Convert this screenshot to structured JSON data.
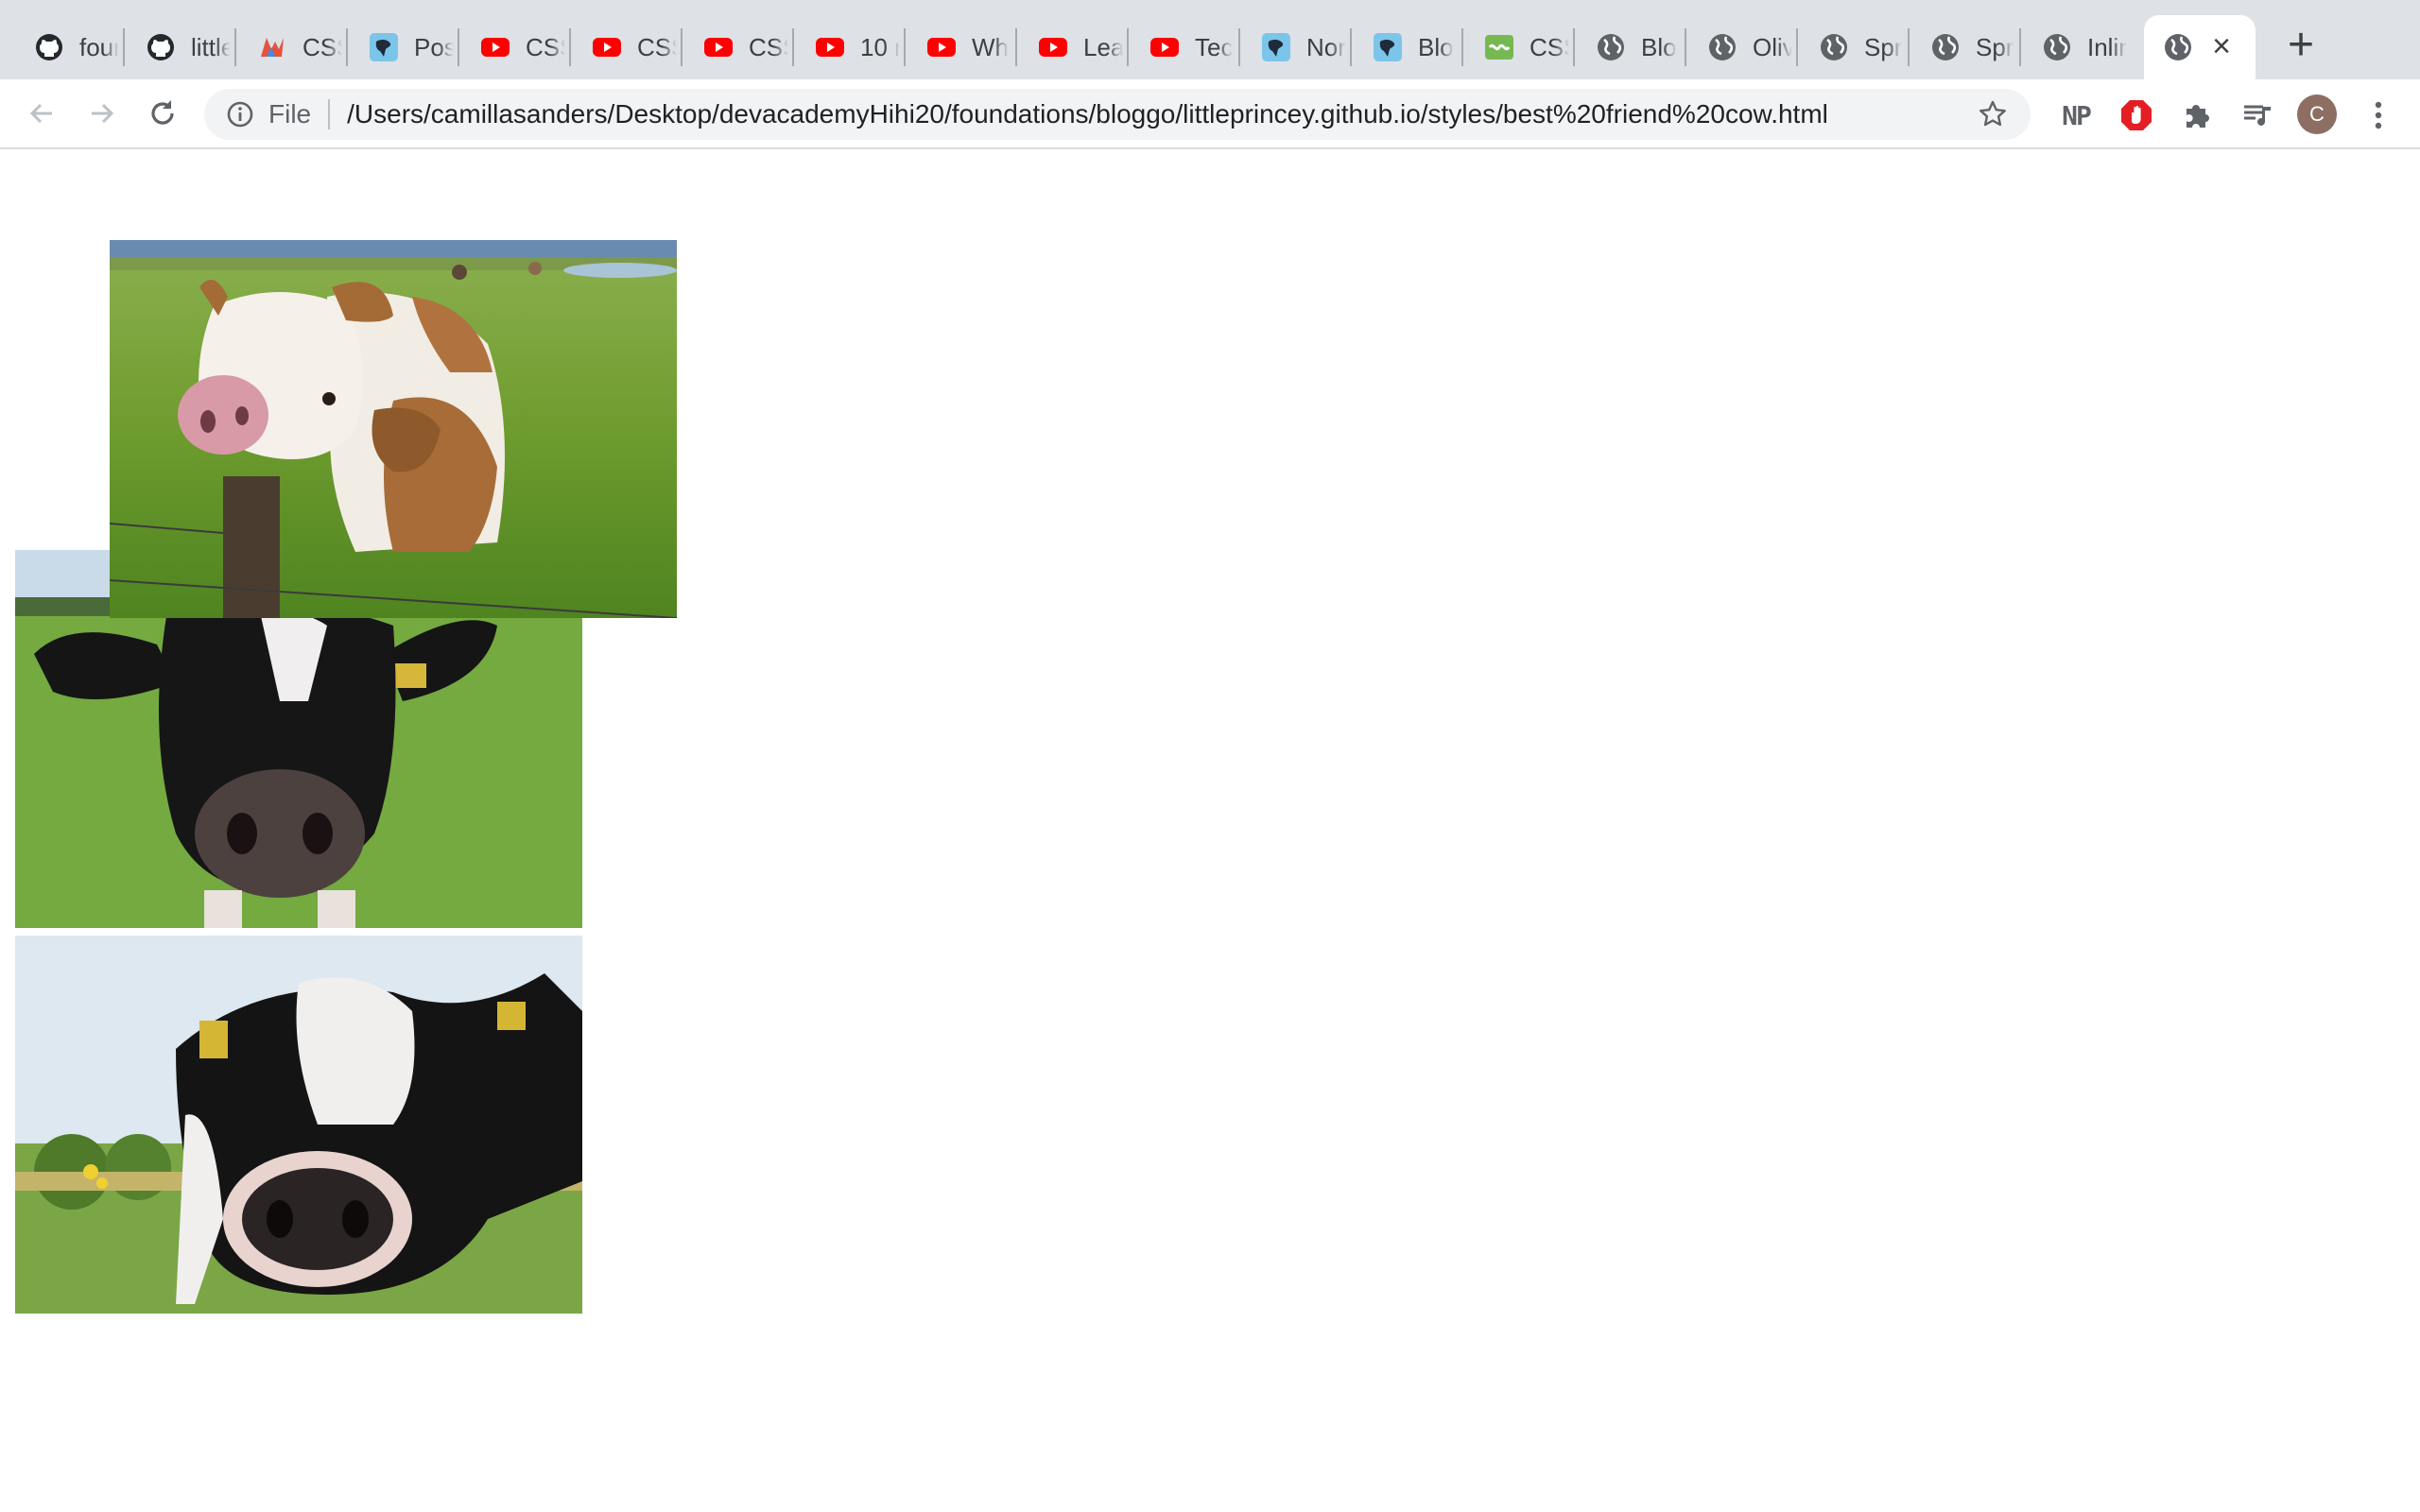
{
  "browser": {
    "tabs": [
      {
        "title": "four",
        "icon": "github-icon"
      },
      {
        "title": "little",
        "icon": "github-icon"
      },
      {
        "title": "CSS",
        "icon": "css-tricks-icon"
      },
      {
        "title": "Pos",
        "icon": "site-icon"
      },
      {
        "title": "CSS",
        "icon": "youtube-icon"
      },
      {
        "title": "CSS",
        "icon": "youtube-icon"
      },
      {
        "title": "CSS",
        "icon": "youtube-icon"
      },
      {
        "title": "10 r",
        "icon": "youtube-icon"
      },
      {
        "title": "Wh",
        "icon": "youtube-icon"
      },
      {
        "title": "Lea",
        "icon": "youtube-icon"
      },
      {
        "title": "Tec",
        "icon": "youtube-icon"
      },
      {
        "title": "Nor",
        "icon": "site-icon"
      },
      {
        "title": "Blo",
        "icon": "site-icon"
      },
      {
        "title": "CSS",
        "icon": "green-site-icon"
      },
      {
        "title": "Blo",
        "icon": "globe-icon"
      },
      {
        "title": "Oliv",
        "icon": "globe-icon"
      },
      {
        "title": "Spr",
        "icon": "globe-icon"
      },
      {
        "title": "Spr",
        "icon": "globe-icon"
      },
      {
        "title": "Inlin",
        "icon": "globe-icon"
      }
    ],
    "active_tab": {
      "title": "",
      "icon": "globe-icon",
      "close": "×"
    },
    "new_tab": "+",
    "omnibox": {
      "scheme_label": "File",
      "url": "/Users/camillasanders/Desktop/devacademyHihi20/foundations/bloggo/littleprincey.github.io/styles/best%20friend%20cow.html"
    },
    "extensions": {
      "np_label": "NP",
      "avatar_initial": "C"
    }
  },
  "page": {
    "images": [
      {
        "name": "cow-brown-white-fence",
        "alt": ""
      },
      {
        "name": "cow-black-white-nose",
        "alt": ""
      },
      {
        "name": "cow-black-white-closeup",
        "alt": ""
      }
    ]
  },
  "colors": {
    "tabstrip_bg": "#dee1e6",
    "toolbar_bg": "#ffffff",
    "omnibox_bg": "#f1f3f4",
    "youtube_red": "#ff0000",
    "adblock_red": "#e31e24"
  }
}
